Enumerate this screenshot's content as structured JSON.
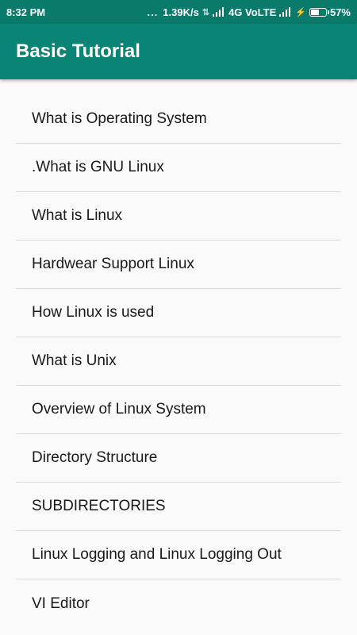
{
  "status_bar": {
    "time": "8:32 PM",
    "dots": "...",
    "speed": "1.39K/s",
    "network": "4G VoLTE",
    "battery_percent": "57%",
    "battery_level": 0.57
  },
  "app_bar": {
    "title": "Basic Tutorial",
    "color": "#0a8575"
  },
  "topics": [
    "What is Operating System",
    ".What is GNU Linux",
    "What is Linux",
    "Hardwear Support Linux",
    "How Linux is used",
    "What is Unix",
    "Overview of Linux System",
    "Directory Structure",
    "SUBDIRECTORIES",
    "Linux Logging and Linux Logging Out",
    "VI Editor"
  ]
}
